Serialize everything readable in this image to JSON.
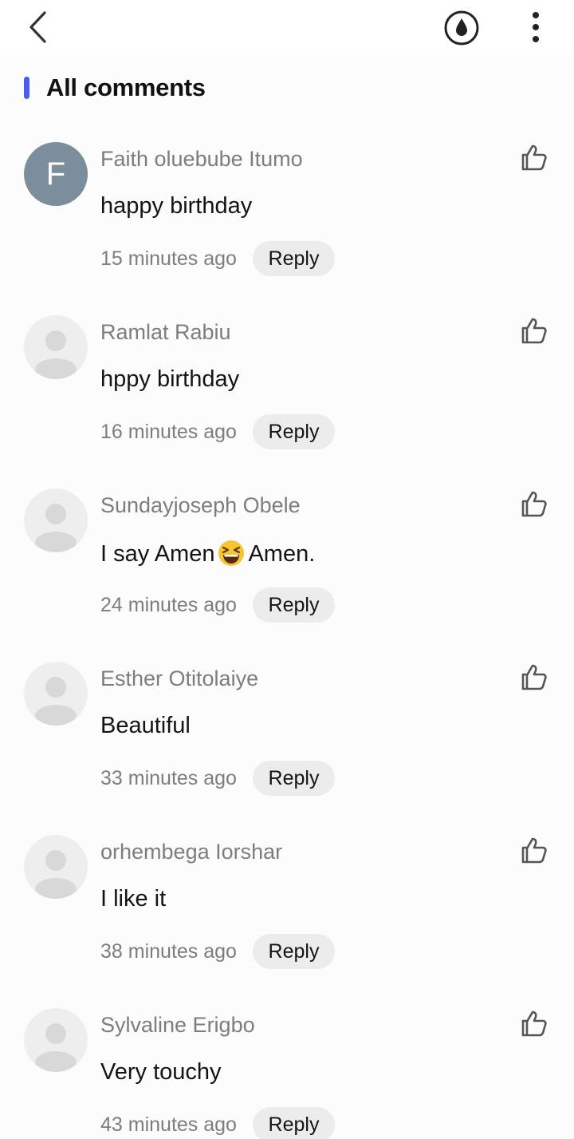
{
  "header": {
    "back_icon": "chevron-left-icon",
    "ink_icon": "ink-drop-icon",
    "more_icon": "more-vertical-icon"
  },
  "section": {
    "title": "All comments",
    "accent_color": "#4a5cf0"
  },
  "comments": [
    {
      "author": "Faith oluebube Itumo",
      "avatar_letter": "F",
      "text": "happy birthday",
      "time": "15 minutes ago",
      "reply_label": "Reply"
    },
    {
      "author": "Ramlat Rabiu",
      "avatar_letter": "",
      "text": "hppy birthday",
      "time": "16 minutes ago",
      "reply_label": "Reply"
    },
    {
      "author": "Sundayjoseph Obele",
      "avatar_letter": "",
      "text_before_emoji": "I say Amen",
      "emoji": "grinning-squinting-face-emoji",
      "text_after_emoji": "Amen.",
      "time": "24 minutes ago",
      "reply_label": "Reply"
    },
    {
      "author": "Esther Otitolaiye",
      "avatar_letter": "",
      "text": "Beautiful",
      "time": "33 minutes ago",
      "reply_label": "Reply"
    },
    {
      "author": "orhembega Iorshar",
      "avatar_letter": "",
      "text": "I like it",
      "time": "38 minutes ago",
      "reply_label": "Reply"
    },
    {
      "author": "Sylvaline Erigbo",
      "avatar_letter": "",
      "text": "Very touchy",
      "time": "43 minutes ago",
      "reply_label": "Reply"
    }
  ]
}
